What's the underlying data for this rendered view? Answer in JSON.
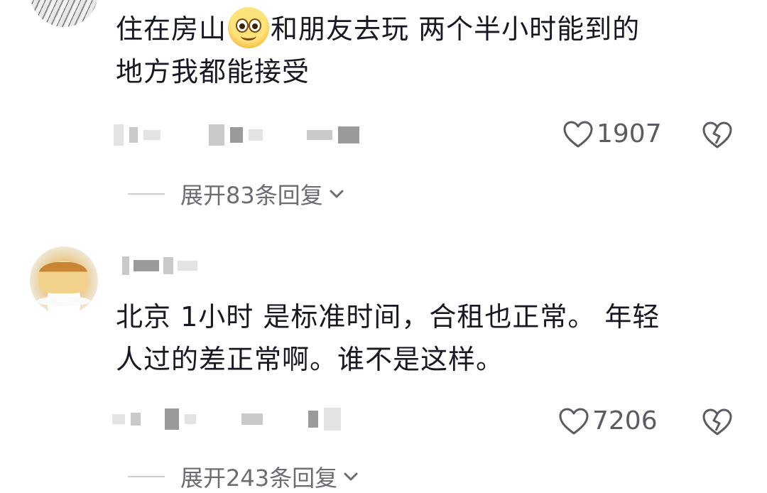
{
  "comments": [
    {
      "text_line1": "住在房山",
      "emoji": "smiley-face-emoji",
      "text_line1_rest": "和朋友去玩 两个半小时能到的",
      "text_line2": "地方我都能接受",
      "likes": "1907",
      "replies_label": "展开83条回复"
    },
    {
      "text_line1": "北京 1小时 是标准时间，合租也正常。 年轻",
      "text_line2": "人过的差正常啊。谁不是这样。",
      "likes": "7206",
      "replies_label": "展开243条回复"
    }
  ],
  "icons": {
    "like": "heart-outline-icon",
    "dislike": "broken-heart-icon",
    "expand": "chevron-down-icon"
  },
  "colors": {
    "text": "#161823",
    "meta": "#5a5b63",
    "reply": "#6b6c73"
  }
}
